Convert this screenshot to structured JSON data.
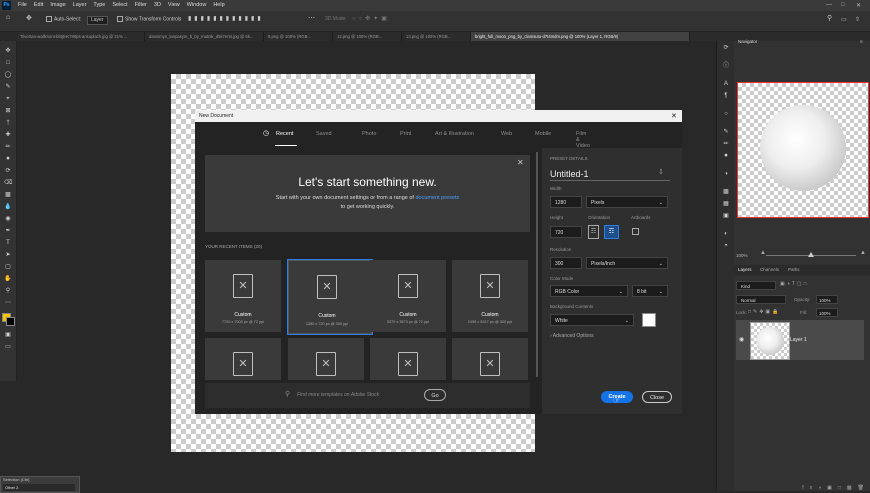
{
  "menubar": {
    "items": [
      "File",
      "Edit",
      "Image",
      "Layer",
      "Type",
      "Select",
      "Filter",
      "3D",
      "View",
      "Window",
      "Help"
    ]
  },
  "optbar": {
    "auto_select": "Auto-Select:",
    "layer_value": "Layer",
    "show_transform": "Show Transform Controls",
    "mode_3d": "3D Mode:"
  },
  "tabs": [
    "Tilvertan-wallknont-bbtjtnK780ps-ansuplach.jpg @ 21% ...",
    "dannimyn_lanpasym_5_by_matnik_d5k7ert4.jpg @ 6k...",
    "5.png @ 100% (RGB...",
    "12.png @ 100% (RGB...",
    "13.png @ 100% (RGB...",
    "bright_full_moon_png_by_clamsuto-d7t4mdm.png @ 100% (Layer 1, RGB/8)"
  ],
  "dialog": {
    "title": "New Document",
    "tabs": [
      "Recent",
      "Saved",
      "Photo",
      "Print",
      "Art & Illustration",
      "Web",
      "Mobile",
      "Film & Video"
    ],
    "hero_title": "Let's start something new.",
    "hero_line1": "Start with your own document settings or from a range of",
    "hero_link": "document presets",
    "hero_line2": "to get working quickly.",
    "recent_label": "YOUR RECENT ITEMS",
    "recent_count": "(20)",
    "cards": [
      {
        "name": "Custom",
        "size": "7700 x 7000 px @ 72 ppi"
      },
      {
        "name": "Custom",
        "size": "1280 x 720 px @ 300 ppi"
      },
      {
        "name": "Custom",
        "size": "3379 x 3573 px @ 72 ppi"
      },
      {
        "name": "Custom",
        "size": "2495 x 5317 px @ 300 ppi"
      }
    ],
    "search_placeholder": "Find more templates on Adobe Stock",
    "go": "Go"
  },
  "presets": {
    "header": "PRESET DETAILS",
    "name": "Untitled-1",
    "width_label": "Width",
    "width": "1280",
    "width_unit": "Pixels",
    "height_label": "Height",
    "height": "720",
    "orientation_label": "Orientation",
    "artboards_label": "Artboards",
    "resolution_label": "Resolution",
    "resolution": "300",
    "resolution_unit": "Pixels/Inch",
    "colormode_label": "Color Mode",
    "colormode": "RGB Color",
    "bits": "8 bit",
    "bg_label": "Background Contents",
    "bg": "White",
    "advanced": "Advanced Options",
    "create": "Create",
    "close": "Close"
  },
  "navigator": {
    "title": "Navigator",
    "zoom": "100%"
  },
  "layers": {
    "tabs": [
      "Layers",
      "Channels",
      "Paths"
    ],
    "kind": "Kind",
    "blend": "Normal",
    "opacity_label": "Opacity:",
    "opacity": "100%",
    "lock_label": "Lock:",
    "fill_label": "Fill:",
    "fill": "100%",
    "layer_name": "Layer 1"
  },
  "mini": {
    "a": "Selection (Ctrl)",
    "b": "Other 2"
  },
  "colors": {
    "accent": "#2d7ee6",
    "link": "#4d9eff"
  }
}
